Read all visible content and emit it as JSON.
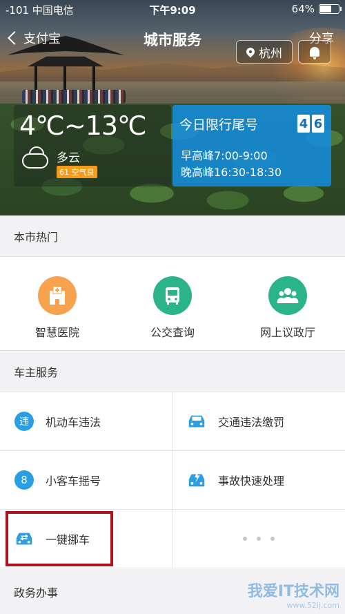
{
  "status_bar": {
    "carrier": "-101 中国电信",
    "time": "下午9:09",
    "battery": "64%",
    "battery_level": 0.64
  },
  "nav": {
    "back_label": "支付宝",
    "title": "城市服务",
    "share_label": "分享",
    "city": "杭州"
  },
  "weather": {
    "temperature": "4℃~13℃",
    "condition": "多云",
    "aqi": "61 空气良"
  },
  "traffic": {
    "label": "今日限行尾号",
    "numbers": [
      "4",
      "6"
    ],
    "morning_peak": "早高峰7:00-9:00",
    "evening_peak": "晚高峰16:30-18:30"
  },
  "hot": {
    "title": "本市热门",
    "items": [
      {
        "label": "智慧医院",
        "icon": "hospital-icon",
        "color": "#f7a24c"
      },
      {
        "label": "公交查询",
        "icon": "bus-icon",
        "color": "#2bb38a"
      },
      {
        "label": "网上议政厅",
        "icon": "people-icon",
        "color": "#2bb38a"
      }
    ]
  },
  "owner": {
    "title": "车主服务",
    "items": [
      {
        "label": "机动车违法",
        "icon": "violation-icon"
      },
      {
        "label": "交通违法缴罚",
        "icon": "car-icon"
      },
      {
        "label": "小客车摇号",
        "icon": "lottery-icon"
      },
      {
        "label": "事故快速处理",
        "icon": "accident-car-icon"
      },
      {
        "label": "一键挪车",
        "icon": "move-car-icon"
      }
    ]
  },
  "government": {
    "title": "政务办事"
  },
  "watermark": {
    "text": "我爱IT技术网",
    "url": "www.52ij.com"
  },
  "colors": {
    "accent_blue": "#2a9ee3",
    "highlight_red": "#b0121b",
    "aqi_orange": "#f29b1d"
  }
}
